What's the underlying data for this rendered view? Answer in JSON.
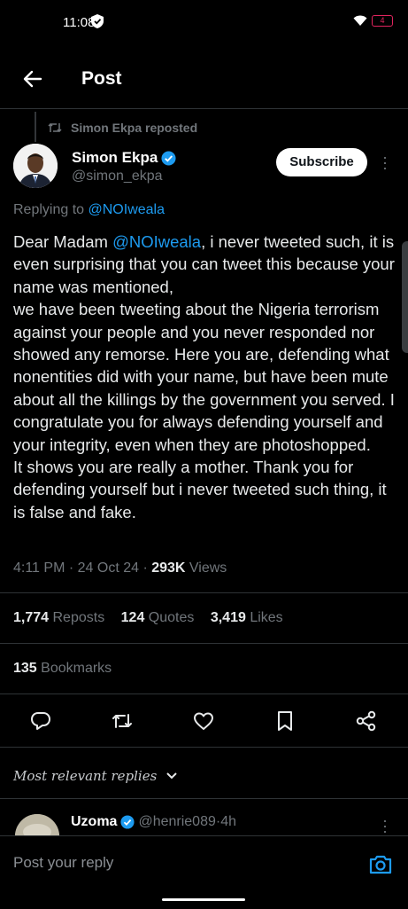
{
  "status": {
    "time": "11:08",
    "battery": "4"
  },
  "header": {
    "title": "Post"
  },
  "repost": {
    "text": "Simon Ekpa reposted"
  },
  "author": {
    "name": "Simon Ekpa",
    "handle": "@simon_ekpa"
  },
  "subscribe_label": "Subscribe",
  "replying": {
    "prefix": "Replying to ",
    "mention": "@NOIweala"
  },
  "tweet": {
    "prefix": "Dear Madam ",
    "mention": "@NOIweala",
    "body1": ", i never tweeted such, it is even surprising that you can tweet this because your name was mentioned,",
    "body2": "we have been tweeting about the Nigeria terrorism against your people and you never responded nor showed any remorse. Here you are, defending what nonentities did with your name, but have been mute about all the killings by the government you served. I congratulate you for always defending yourself and your integrity, even when they are photoshopped.",
    "body3": "It shows you are really a mother. Thank you for defending yourself but i never tweeted such thing, it is false and fake."
  },
  "meta": {
    "time": "4:11 PM",
    "sep": " · ",
    "date": "24 Oct 24",
    "views_count": "293K",
    "views_label": " Views"
  },
  "stats": {
    "reposts_count": "1,774",
    "reposts_label": " Reposts",
    "quotes_count": "124",
    "quotes_label": " Quotes",
    "likes_count": "3,419",
    "likes_label": " Likes",
    "bookmarks_count": "135",
    "bookmarks_label": " Bookmarks"
  },
  "actions": [
    "reply-icon",
    "repost-icon",
    "like-icon",
    "bookmark-icon",
    "share-icon"
  ],
  "replies": {
    "filter_label": "Most relevant replies"
  },
  "reply_preview": {
    "name": "Uzoma",
    "handle": "@henrie089",
    "sep": " · ",
    "time": "4h"
  },
  "reply_bar": {
    "placeholder": "Post your reply"
  },
  "colors": {
    "accent": "#1d9bf0",
    "background": "#000000",
    "muted": "#71767b"
  }
}
